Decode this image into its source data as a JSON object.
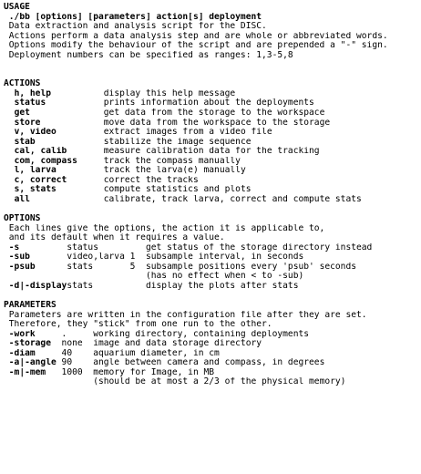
{
  "usage": {
    "heading": "USAGE",
    "syntax": {
      "cmd": "./bb [options] [parameters] action[s] deployment"
    },
    "desc": [
      "Data extraction and analysis script for the DISC.",
      "Actions perform a data analysis step and are whole or abbreviated words.",
      "Options modify the behaviour of the script and are prepended a \"-\" sign.",
      "Deployment numbers can be specified as ranges: 1,3-5,8"
    ]
  },
  "actions": {
    "heading": "ACTIONS",
    "items": [
      {
        "name": "h, help",
        "desc": "display this help message"
      },
      {
        "name": "status",
        "desc": "prints information about the deployments"
      },
      {
        "name": "get",
        "desc": "get data from the storage to the workspace"
      },
      {
        "name": "store",
        "desc": "move data from the workspace to the storage"
      },
      {
        "name": "v, video",
        "desc": "extract images from a video file"
      },
      {
        "name": "stab",
        "desc": "stabilize the image sequence"
      },
      {
        "name": "cal, calib",
        "desc": "measure calibration data for the tracking"
      },
      {
        "name": "com, compass",
        "desc": "track the compass manually"
      },
      {
        "name": "l, larva",
        "desc": "track the larva(e) manually"
      },
      {
        "name": "c, correct",
        "desc": "correct the tracks"
      },
      {
        "name": "s, stats",
        "desc": "compute statistics and plots"
      },
      {
        "name": "all",
        "desc": "calibrate, track larva, correct and compute stats"
      }
    ]
  },
  "options": {
    "heading": "OPTIONS",
    "intro": [
      "Each lines give the options, the action it is applicable to,",
      "and its default when it requires a value."
    ],
    "items": [
      {
        "flag": "-s",
        "action": "status",
        "default": "",
        "desc": "get status of the storage directory instead"
      },
      {
        "flag": "-sub",
        "action": "video,larva",
        "default": "1",
        "desc": "subsample interval, in seconds"
      },
      {
        "flag": "-psub",
        "action": "stats",
        "default": "5",
        "desc": "subsample positions every 'psub' seconds"
      },
      {
        "flag": "",
        "action": "",
        "default": "",
        "desc": "(has no effect when < to -sub)"
      },
      {
        "flag": "-d|-display",
        "action": "stats",
        "default": "",
        "desc": "display the plots after stats"
      }
    ]
  },
  "parameters": {
    "heading": "PARAMETERS",
    "intro": [
      "Parameters are written in the configuration file after they are set.",
      "Therefore, they \"stick\" from one run to the other."
    ],
    "items": [
      {
        "flag": "-work",
        "default": ".",
        "desc": "working directory, containing deployments"
      },
      {
        "flag": "-storage",
        "default": "none",
        "desc": "image and data storage directory"
      },
      {
        "flag": "-diam",
        "default": "40",
        "desc": "aquarium diameter, in cm"
      },
      {
        "flag": "-a|-angle",
        "default": "90",
        "desc": "angle between camera and compass, in degrees"
      },
      {
        "flag": "-m|-mem",
        "default": "1000",
        "desc": "memory for Image, in MB"
      },
      {
        "flag": "",
        "default": "",
        "desc": "(should be at most a 2/3 of the physical memory)"
      }
    ]
  }
}
